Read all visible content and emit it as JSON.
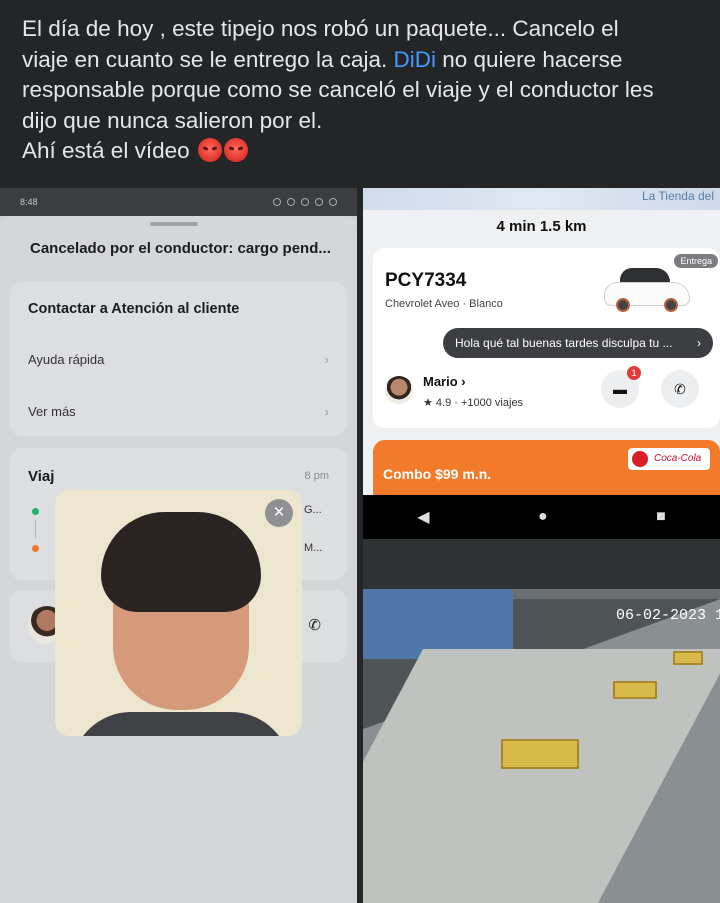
{
  "post": {
    "line1": "El día de hoy , este tipejo nos robó un paquete... Cancelo el",
    "line2a": "viaje en cuanto se le entrego la caja. ",
    "link": "DiDi",
    "line2b": " no quiere hacerse",
    "line3": "responsable porque como se canceló el viaje y el conductor les",
    "line4": "dijo que nunca salieron por el.",
    "line5": "Ahí está el vídeo"
  },
  "left_screen": {
    "status_time": "8:48",
    "title": "Cancelado por el conductor: cargo pend...",
    "support": {
      "heading": "Contactar a Atención al cliente",
      "items": [
        "Ayuda rápida",
        "Ver más"
      ]
    },
    "trip": {
      "heading": "Viaj",
      "time": "8 pm",
      "pickup": "G...",
      "dropoff": "M..."
    }
  },
  "right_screen": {
    "map_label": "La Tienda del",
    "eta": "4 min  1.5 km",
    "tag": "Entrega",
    "plate": "PCY7334",
    "car": "Chevrolet Aveo · Blanco",
    "message": "Hola qué tal buenas tardes disculpa tu ...",
    "driver_name": "Mario ›",
    "rating": "★ 4.9 · +1000 viajes",
    "chat_badge": "1",
    "promo_text": "Combo $99 m.n.",
    "promo_brand": "Coca-Cola"
  },
  "cctv": {
    "timestamp": "06-02-2023 1"
  },
  "colors": {
    "link": "#4599ff",
    "promo": "#f27a2b"
  }
}
